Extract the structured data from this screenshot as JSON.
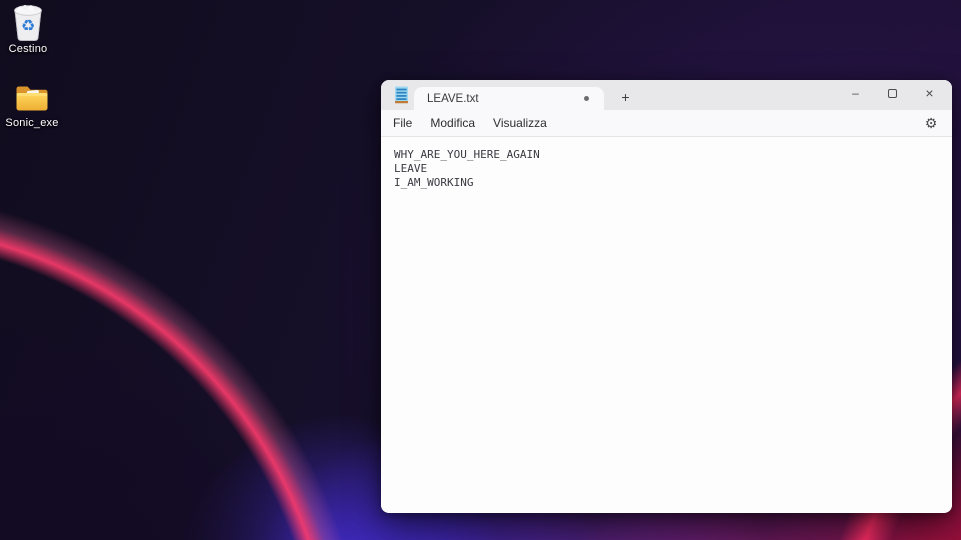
{
  "desktop": {
    "icons": [
      {
        "label": "Cestino",
        "icon": "recycle-bin-icon",
        "recycle_glyph": "♻"
      },
      {
        "label": "Sonic_exe",
        "icon": "folder-icon"
      }
    ]
  },
  "notepad": {
    "app_icon": "notepad-icon",
    "tab": {
      "title": "LEAVE.txt",
      "modified": true
    },
    "new_tab_button": "+",
    "window_controls": {
      "minimize": "–",
      "maximize": "□",
      "close": "×"
    },
    "menu": {
      "items": [
        "File",
        "Modifica",
        "Visualizza"
      ]
    },
    "settings": {
      "icon": "gear-icon",
      "glyph": "⚙"
    },
    "editor": {
      "lines": [
        "WHY_ARE_YOU_HERE_AGAIN",
        "LEAVE",
        "I_AM_WORKING"
      ]
    }
  },
  "colors": {
    "titlebar_bg": "#e8e7ea",
    "tab_bg": "#f9f8fa",
    "editor_bg": "#fdfdfd",
    "editor_text": "#3a3a42",
    "wallpaper_base": "#150e26",
    "wallpaper_blue": "#3e28cd",
    "wallpaper_purple": "#7a2cac",
    "wallpaper_magenta": "#a51e70",
    "wallpaper_red": "#b2103e",
    "wallpaper_arc_pink": "#ff3c6e",
    "folder_yellow": "#f5b73a",
    "notepad_icon_blue": "#8ecdee",
    "recycle_symbol_blue": "#2e7cd6"
  }
}
